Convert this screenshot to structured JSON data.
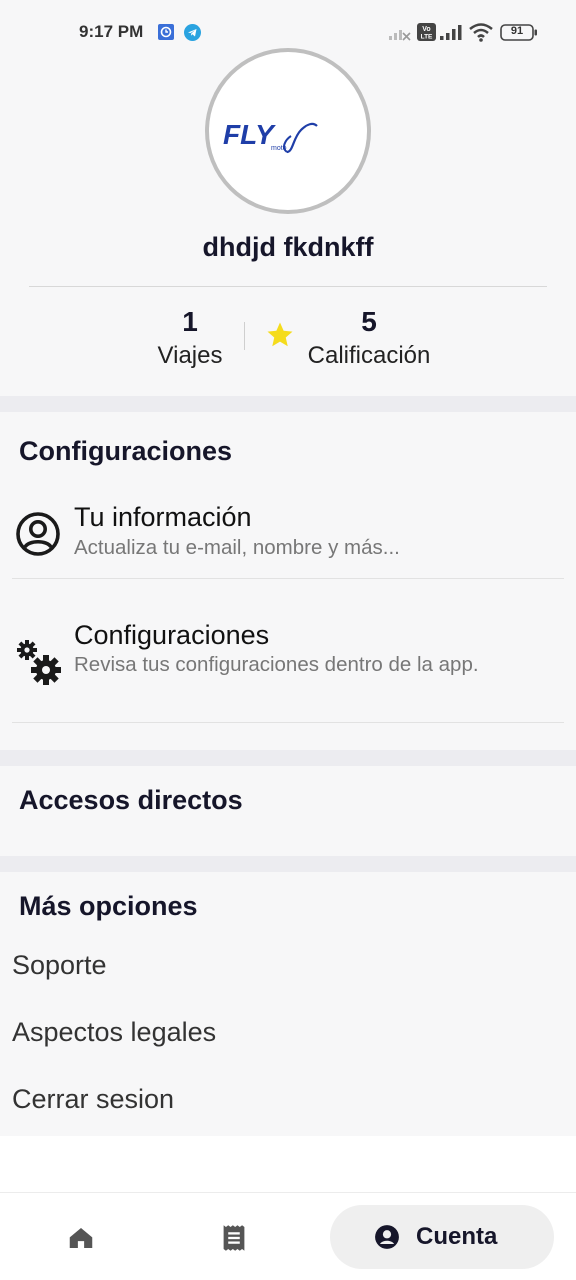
{
  "status_bar": {
    "time": "9:17 PM",
    "battery": "91",
    "volte": "Vo LTE"
  },
  "profile": {
    "logo_text": "FLY",
    "logo_sub": "moto",
    "name": "dhdjd fkdnkff",
    "trips_count": "1",
    "trips_label": "Viajes",
    "rating_value": "5",
    "rating_label": "Calificación",
    "star_color": "#f5dc1d"
  },
  "settings": {
    "title": "Configuraciones",
    "items": [
      {
        "icon": "account-circle-icon",
        "title": "Tu información",
        "subtitle": "Actualiza tu e-mail, nombre y más..."
      },
      {
        "icon": "gears-icon",
        "title": "Configuraciones",
        "subtitle": "Revisa tus configuraciones dentro de la app."
      }
    ]
  },
  "shortcuts": {
    "title": "Accesos directos"
  },
  "more_options": {
    "title": "Más opciones",
    "items": [
      "Soporte",
      "Aspectos legales",
      "Cerrar sesion"
    ]
  },
  "bottom_nav": {
    "home_icon": "home-icon",
    "trips_icon": "receipt-icon",
    "account_label": "Cuenta"
  }
}
